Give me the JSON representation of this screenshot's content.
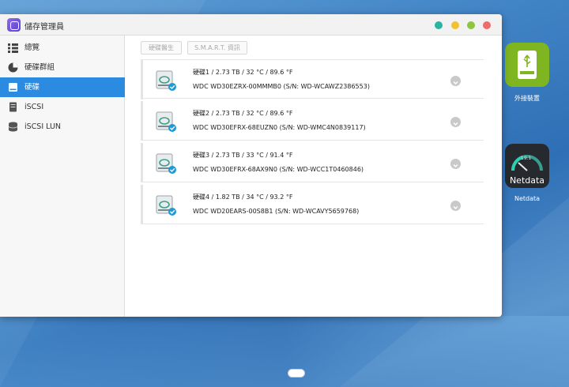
{
  "window": {
    "title": "儲存管理員"
  },
  "titlebar_buttons": [
    {
      "name": "help",
      "color": "#2bb3a3"
    },
    {
      "name": "minimize",
      "color": "#f2c12e"
    },
    {
      "name": "maximize",
      "color": "#8dc63f"
    },
    {
      "name": "close",
      "color": "#f06b6b"
    }
  ],
  "sidebar": {
    "items": [
      {
        "label": "總覽",
        "icon": "overview-icon",
        "active": false
      },
      {
        "label": "硬碟群組",
        "icon": "disk-group-icon",
        "active": false
      },
      {
        "label": "硬碟",
        "icon": "hdd-icon",
        "active": true
      },
      {
        "label": "iSCSI",
        "icon": "iscsi-icon",
        "active": false
      },
      {
        "label": "iSCSI LUN",
        "icon": "iscsi-lun-icon",
        "active": false
      }
    ]
  },
  "toolbar": {
    "disk_info_label": "硬碟醫生",
    "smart_label": "S.M.A.R.T. 資訊"
  },
  "disks": [
    {
      "summary": "硬碟1 / 2.73 TB / 32 °C / 89.6 °F",
      "model": "WDC WD30EZRX-00MMMB0 (S/N: WD-WCAWZ2386553)"
    },
    {
      "summary": "硬碟2 / 2.73 TB / 32 °C / 89.6 °F",
      "model": "WDC WD30EFRX-68EUZN0 (S/N: WD-WMC4N0839117)"
    },
    {
      "summary": "硬碟3 / 2.73 TB / 33 °C / 91.4 °F",
      "model": "WDC WD30EFRX-68AX9N0 (S/N: WD-WCC1T0460846)"
    },
    {
      "summary": "硬碟4 / 1.82 TB / 34 °C / 93.2 °F",
      "model": "WDC WD20EARS-00S8B1 (S/N: WD-WCAVY5659768)"
    }
  ],
  "desktop": {
    "external_device_label": "外接裝置",
    "netdata_label": "Netdata",
    "netdata_tile_text": "Netdata",
    "netdata_gauge_value": "19.1"
  },
  "colors": {
    "accent": "#2a8be0",
    "status_ok": "#1e9ad6",
    "usb_tile": "#7fb520",
    "netdata_tile": "#262a2e"
  }
}
